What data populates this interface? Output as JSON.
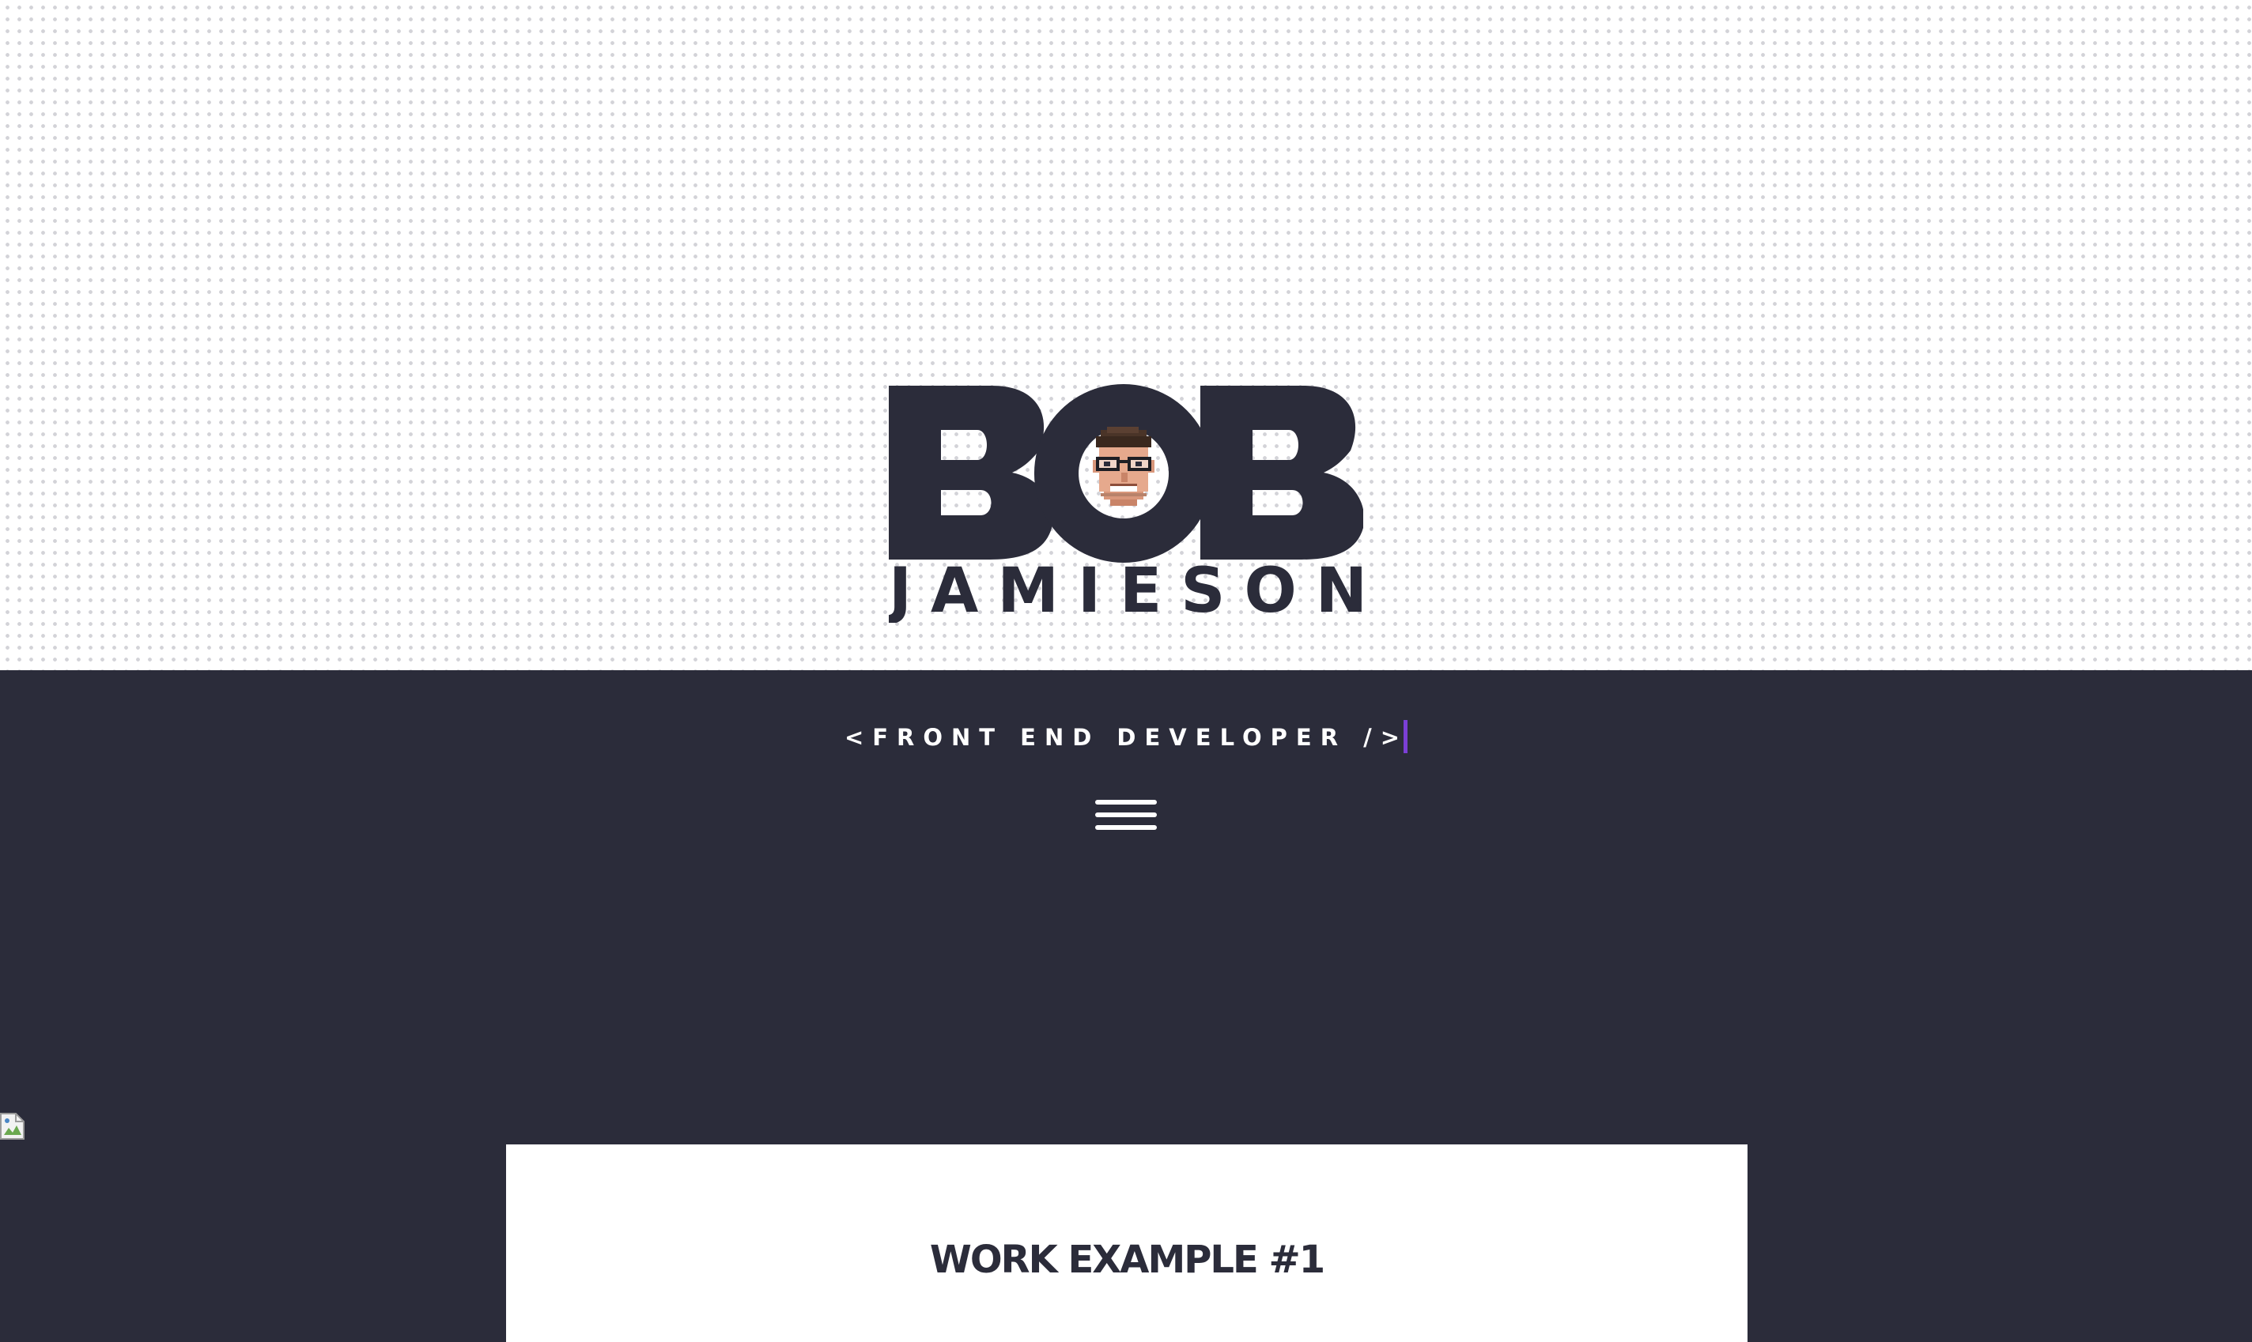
{
  "header": {
    "logo": {
      "first_name": "BOB",
      "last_name": "JAMIESON",
      "avatar_icon": "pixel-avatar-face-icon"
    }
  },
  "tagline": {
    "text": "<FRONT END DEVELOPER />"
  },
  "nav": {
    "menu_icon": "hamburger-menu-icon"
  },
  "work": {
    "title": "WORK EXAMPLE #1"
  },
  "colors": {
    "dark": "#2b2c3a",
    "white": "#ffffff",
    "cursor_accent": "#7b3fd6",
    "dot_pattern": "#d3d3d8"
  }
}
